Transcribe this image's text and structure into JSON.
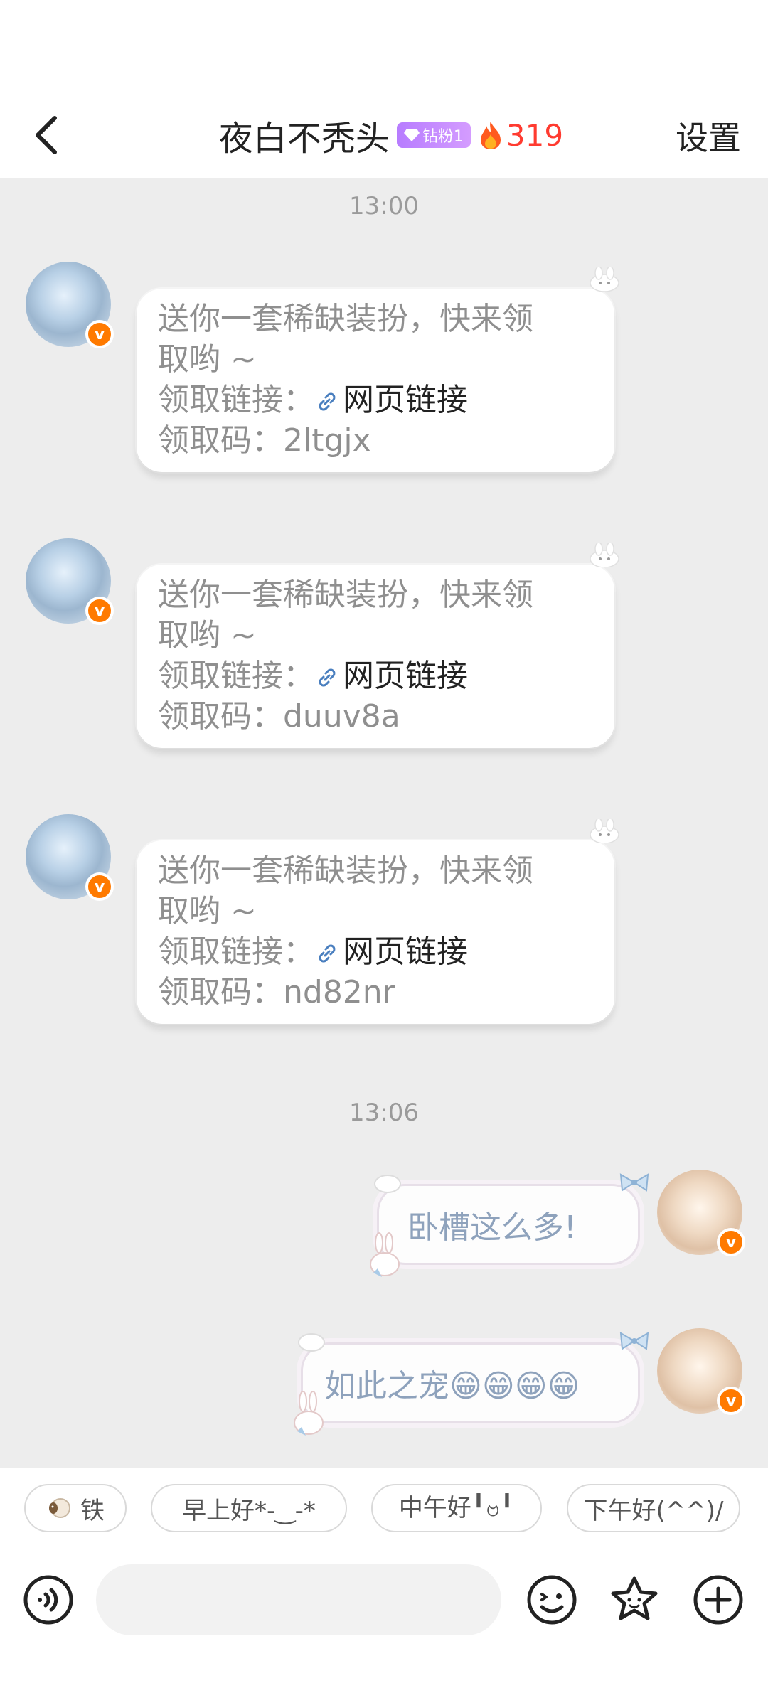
{
  "header": {
    "title": "夜白不秃头",
    "fan_badge": "钻粉1",
    "fire_count": "319",
    "settings_label": "设置"
  },
  "messages": {
    "time_1": "13:00",
    "gift_1": {
      "line1": "送你一套稀缺装扮，快来领",
      "line2": "取哟 ~",
      "link_prefix": "领取链接：",
      "link_text": "网页链接",
      "code_line": "领取码：2ltgjx"
    },
    "gift_2": {
      "line1": "送你一套稀缺装扮，快来领",
      "line2": "取哟 ~",
      "link_prefix": "领取链接：",
      "link_text": "网页链接",
      "code_line": "领取码：duuv8a"
    },
    "gift_3": {
      "line1": "送你一套稀缺装扮，快来领",
      "line2": "取哟 ~",
      "link_prefix": "领取链接：",
      "link_text": "网页链接",
      "code_line": "领取码：nd82nr"
    },
    "time_2": "13:06",
    "my_1": "卧槽这么多!",
    "my_2": "如此之宠😁😁😁😁"
  },
  "quick_replies": {
    "chip_1": "铁",
    "chip_2": "早上好*-‿-*",
    "chip_3": "中午好╹ဗ╹",
    "chip_4": "下午好(^^)/"
  },
  "input": {
    "placeholder": ""
  },
  "avatar_badge": "v",
  "colors": {
    "accent_orange": "#ff7a00",
    "fire_red": "#ff3b30",
    "fan_purple": "#b77cff"
  }
}
